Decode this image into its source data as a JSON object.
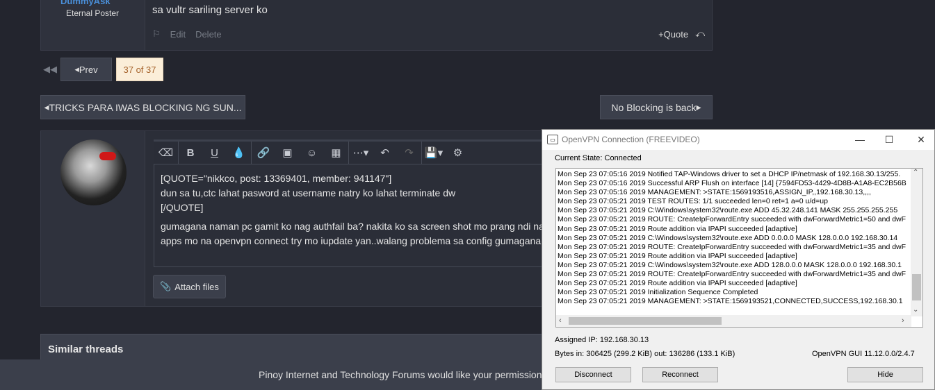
{
  "post": {
    "username": "DummyAsk",
    "user_title": "Eternal Poster",
    "message": "sa vultr sariling server ko",
    "edit": "Edit",
    "delete": "Delete",
    "quote": "Quote"
  },
  "pagination": {
    "prev": "Prev",
    "current": "37 of 37"
  },
  "threads": {
    "previous": "TRICKS PARA IWAS BLOCKING NG SUN...",
    "next": "No Blocking is back"
  },
  "editor": {
    "lines": [
      "[QUOTE=\"nikkco, post: 13369401, member: 941147\"]",
      "dun sa tu,ctc lahat pasword at username natry ko lahat terminate dw",
      "[/QUOTE]",
      "gumagana naman pc gamit ko nag authfail ba? nakita ko sa screen shot mo prang ndi na",
      "apps mo na openvpn connect try mo iupdate yan..walang problema sa config gumagana"
    ],
    "attach": "Attach files"
  },
  "similar": "Similar threads",
  "cookie_text": "Pinoy Internet and Technology Forums would like your permission",
  "openvpn": {
    "title": "OpenVPN Connection (FREEVIDEO)",
    "state": "Current State: Connected",
    "log": [
      "Mon Sep 23 07:05:16 2019 Notified TAP-Windows driver to set a DHCP IP/netmask of 192.168.30.13/255.",
      "Mon Sep 23 07:05:16 2019 Successful ARP Flush on interface [14] {7594FD53-4429-4D8B-A1A8-EC2B56B",
      "Mon Sep 23 07:05:16 2019 MANAGEMENT: >STATE:1569193516,ASSIGN_IP,,192.168.30.13,,,,",
      "Mon Sep 23 07:05:21 2019 TEST ROUTES: 1/1 succeeded len=0 ret=1 a=0 u/d=up",
      "Mon Sep 23 07:05:21 2019 C:\\Windows\\system32\\route.exe ADD 45.32.248.141 MASK 255.255.255.255",
      "Mon Sep 23 07:05:21 2019 ROUTE: CreateIpForwardEntry succeeded with dwForwardMetric1=50 and dwF",
      "Mon Sep 23 07:05:21 2019 Route addition via IPAPI succeeded [adaptive]",
      "Mon Sep 23 07:05:21 2019 C:\\Windows\\system32\\route.exe ADD 0.0.0.0 MASK 128.0.0.0 192.168.30.14",
      "Mon Sep 23 07:05:21 2019 ROUTE: CreateIpForwardEntry succeeded with dwForwardMetric1=35 and dwF",
      "Mon Sep 23 07:05:21 2019 Route addition via IPAPI succeeded [adaptive]",
      "Mon Sep 23 07:05:21 2019 C:\\Windows\\system32\\route.exe ADD 128.0.0.0 MASK 128.0.0.0 192.168.30.1",
      "Mon Sep 23 07:05:21 2019 ROUTE: CreateIpForwardEntry succeeded with dwForwardMetric1=35 and dwF",
      "Mon Sep 23 07:05:21 2019 Route addition via IPAPI succeeded [adaptive]",
      "Mon Sep 23 07:05:21 2019 Initialization Sequence Completed",
      "Mon Sep 23 07:05:21 2019 MANAGEMENT: >STATE:1569193521,CONNECTED,SUCCESS,192.168.30.1"
    ],
    "assigned_ip": "Assigned IP: 192.168.30.13",
    "bytes": "Bytes in: 306425 (299.2 KiB)  out: 136286 (133.1 KiB)",
    "version": "OpenVPN GUI 11.12.0.0/2.4.7",
    "disconnect": "Disconnect",
    "reconnect": "Reconnect",
    "hide": "Hide"
  }
}
